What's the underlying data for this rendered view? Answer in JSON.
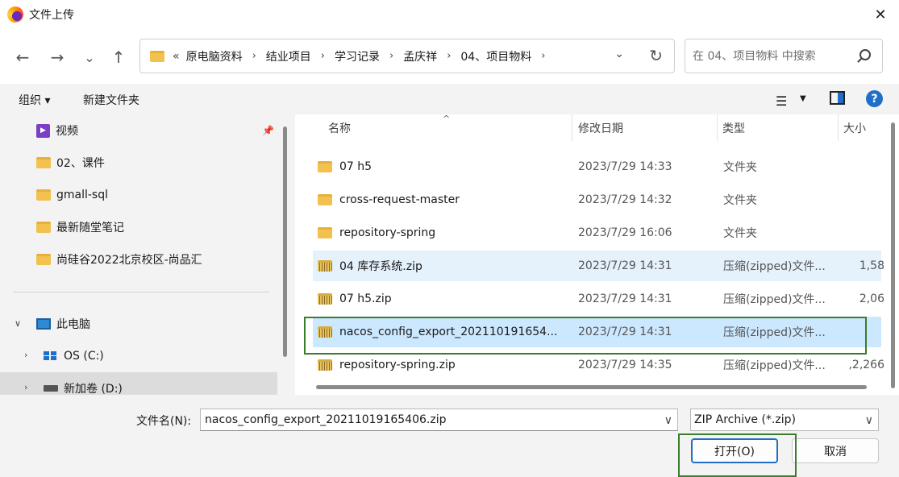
{
  "window": {
    "title": "文件上传",
    "icon": "firefox-icon"
  },
  "nav": {
    "back_icon": "←",
    "forward_icon": "→",
    "recent_icon": "⌄",
    "up_icon": "↑",
    "path_prefix": "«",
    "breadcrumbs": [
      "原电脑资料",
      "结业项目",
      "学习记录",
      "孟庆祥",
      "04、项目物料"
    ],
    "refresh_icon": "↻",
    "search_placeholder": "在 04、项目物料 中搜索"
  },
  "toolbar": {
    "organize": "组织 ▾",
    "new_folder": "新建文件夹",
    "view_icon": "☰",
    "help": "?"
  },
  "sidebar": {
    "items": [
      {
        "label": "视频",
        "icon": "video-icon",
        "pinned": true
      },
      {
        "label": "02、课件",
        "icon": "folder-icon"
      },
      {
        "label": "gmall-sql",
        "icon": "folder-icon"
      },
      {
        "label": "最新随堂笔记",
        "icon": "folder-icon"
      },
      {
        "label": "尚硅谷2022北京校区-尚品汇",
        "icon": "folder-icon"
      }
    ],
    "this_pc": "此电脑",
    "drives": [
      {
        "label": "OS (C:)",
        "icon": "windows-drive-icon"
      },
      {
        "label": "新加卷 (D:)",
        "icon": "drive-icon",
        "selected": true
      }
    ]
  },
  "columns": {
    "name": "名称",
    "date": "修改日期",
    "type": "类型",
    "size": "大小"
  },
  "files": [
    {
      "name": "07 h5",
      "date": "2023/7/29 14:33",
      "type": "文件夹",
      "size": "",
      "kind": "folder"
    },
    {
      "name": "cross-request-master",
      "date": "2023/7/29 14:32",
      "type": "文件夹",
      "size": "",
      "kind": "folder"
    },
    {
      "name": "repository-spring",
      "date": "2023/7/29 16:06",
      "type": "文件夹",
      "size": "",
      "kind": "folder"
    },
    {
      "name": "04 库存系统.zip",
      "date": "2023/7/29 14:31",
      "type": "压缩(zipped)文件...",
      "size": "1,58",
      "kind": "zip"
    },
    {
      "name": "07 h5.zip",
      "date": "2023/7/29 14:31",
      "type": "压缩(zipped)文件...",
      "size": "2,06",
      "kind": "zip"
    },
    {
      "name": "nacos_config_export_202110191654...",
      "date": "2023/7/29 14:31",
      "type": "压缩(zipped)文件...",
      "size": "",
      "kind": "zip",
      "selected": true
    },
    {
      "name": "repository-spring.zip",
      "date": "2023/7/29 14:35",
      "type": "压缩(zipped)文件...",
      "size": "2,266,",
      "kind": "zip"
    }
  ],
  "bottom": {
    "filename_label": "文件名(N):",
    "filename_value": "nacos_config_export_20211019165406.zip",
    "filetype": "ZIP Archive (*.zip)",
    "open": "打开(O)",
    "cancel": "取消"
  },
  "colors": {
    "accent": "#1f6fc9",
    "highlight_box": "#3a7d2c",
    "selected_row": "#cce8ff"
  }
}
